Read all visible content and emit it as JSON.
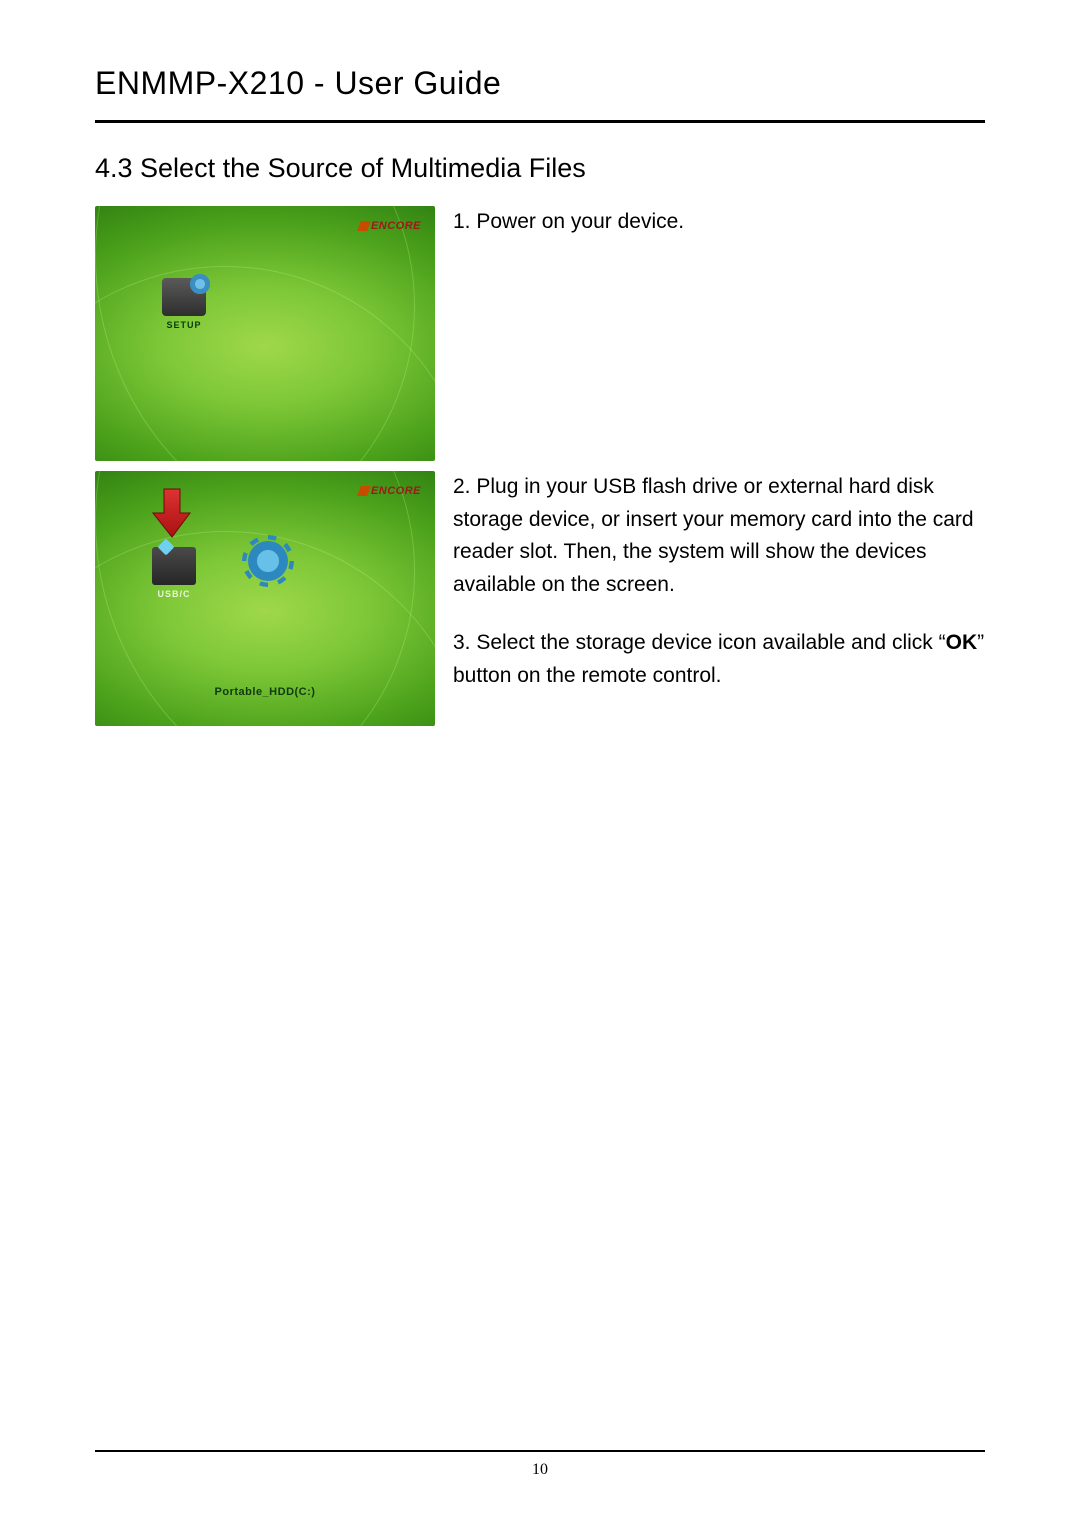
{
  "header": {
    "title": "ENMMP-X210  -  User  Guide"
  },
  "section": {
    "heading": "4.3 Select the Source of Multimedia Files"
  },
  "screenshot1": {
    "brand": "ENCORE",
    "setup_label": "SETUP"
  },
  "screenshot2": {
    "brand": "ENCORE",
    "usb_label": "USB/C",
    "bottom_label": "Portable_HDD(C:)"
  },
  "steps": {
    "s1": "1. Power on your device.",
    "s2": "2. Plug in your USB flash drive or external hard disk storage device, or insert your memory card into the card reader slot. Then, the system will show the devices available on the screen.",
    "s3_pre": "3. Select the storage device icon available and click “",
    "s3_bold": "OK",
    "s3_post": "” button on the remote control."
  },
  "footer": {
    "page_number": "10"
  }
}
